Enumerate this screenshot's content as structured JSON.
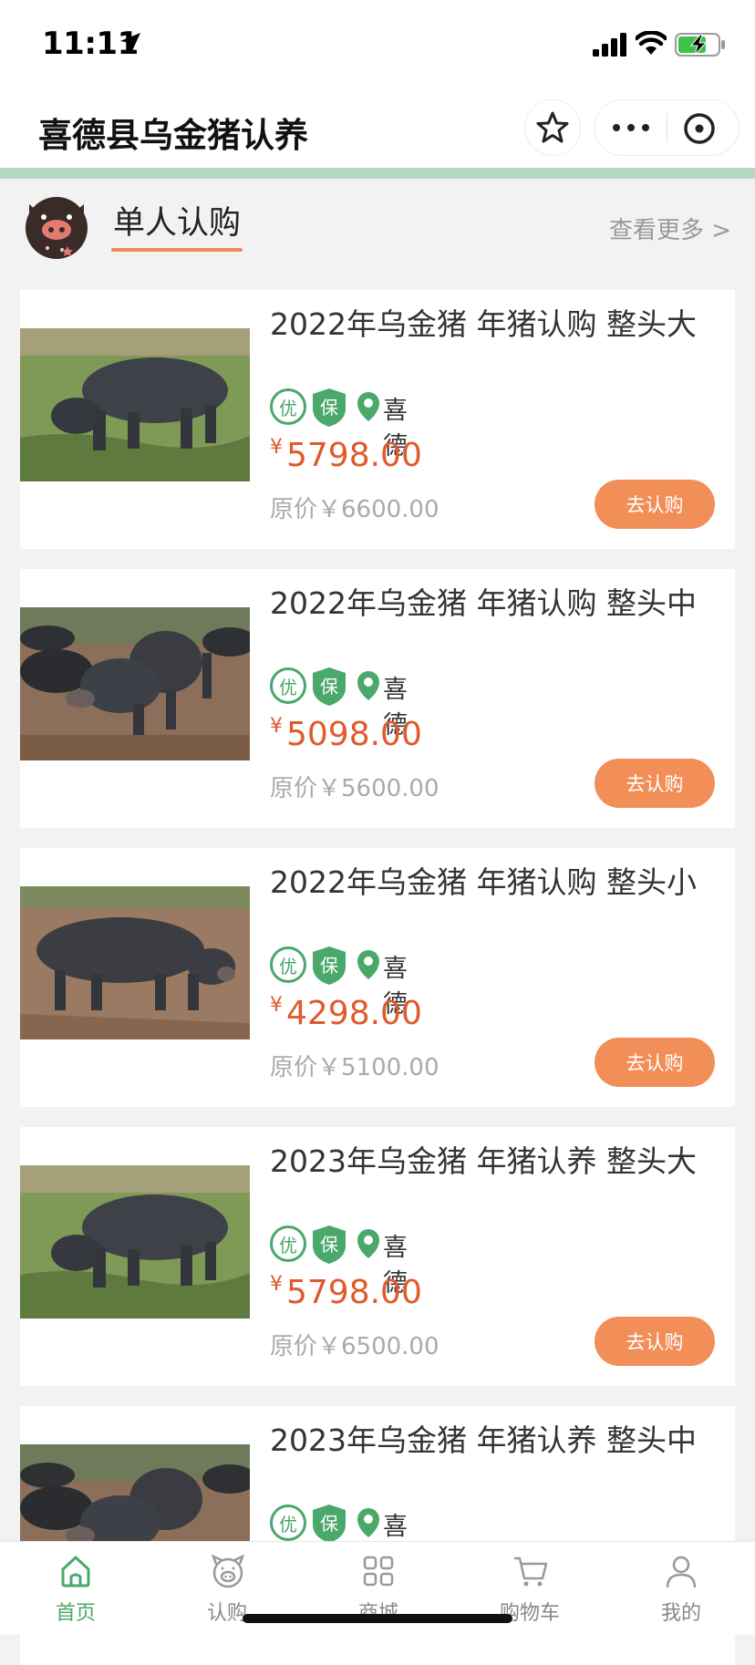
{
  "status_bar": {
    "time": "11:11",
    "icons": [
      "location-arrow-icon",
      "signal-icon",
      "wifi-icon",
      "battery-charging-icon"
    ]
  },
  "nav": {
    "title": "喜德县乌金猪认养",
    "icons": [
      "star-icon",
      "more-icon",
      "close-circle-icon"
    ]
  },
  "section": {
    "title": "单人认购",
    "see_more": "查看更多 >"
  },
  "products": [
    {
      "title": "2022年乌金猪 年猪认购 整头大",
      "badge_you": "优",
      "badge_bao": "保",
      "place": "喜德",
      "currency": "¥",
      "price": "5798.00",
      "original_price": "原价￥6600.00",
      "button": "去认购"
    },
    {
      "title": "2022年乌金猪 年猪认购 整头中",
      "badge_you": "优",
      "badge_bao": "保",
      "place": "喜德",
      "currency": "¥",
      "price": "5098.00",
      "original_price": "原价￥5600.00",
      "button": "去认购"
    },
    {
      "title": "2022年乌金猪 年猪认购 整头小",
      "badge_you": "优",
      "badge_bao": "保",
      "place": "喜德",
      "currency": "¥",
      "price": "4298.00",
      "original_price": "原价￥5100.00",
      "button": "去认购"
    },
    {
      "title": "2023年乌金猪 年猪认养 整头大",
      "badge_you": "优",
      "badge_bao": "保",
      "place": "喜德",
      "currency": "¥",
      "price": "5798.00",
      "original_price": "原价￥6500.00",
      "button": "去认购"
    },
    {
      "title": "2023年乌金猪 年猪认养 整头中",
      "badge_you": "优",
      "badge_bao": "保",
      "place": "喜德",
      "currency": "¥",
      "price": "",
      "original_price": "",
      "button": ""
    }
  ],
  "tabs": [
    {
      "label": "首页",
      "icon": "home-icon",
      "active": true
    },
    {
      "label": "认购",
      "icon": "pig-face-icon",
      "active": false
    },
    {
      "label": "商城",
      "icon": "grid-icon",
      "active": false
    },
    {
      "label": "购物车",
      "icon": "cart-icon",
      "active": false
    },
    {
      "label": "我的",
      "icon": "user-icon",
      "active": false
    }
  ],
  "colors": {
    "accent_green": "#49a86a",
    "price_red": "#e05a2b",
    "button_orange": "#f28e58",
    "divider_green": "#b5d8c2"
  }
}
